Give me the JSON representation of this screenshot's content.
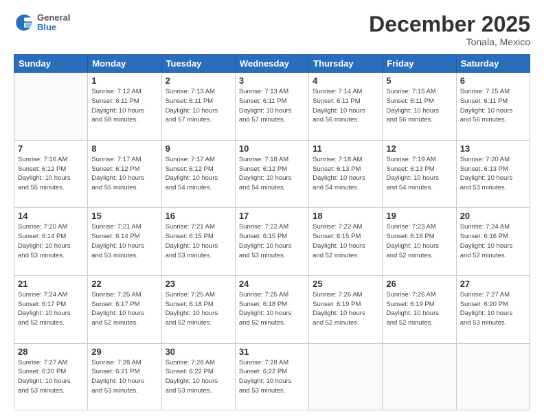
{
  "header": {
    "logo": {
      "general": "General",
      "blue": "Blue"
    },
    "title": "December 2025",
    "location": "Tonala, Mexico"
  },
  "calendar": {
    "days_of_week": [
      "Sunday",
      "Monday",
      "Tuesday",
      "Wednesday",
      "Thursday",
      "Friday",
      "Saturday"
    ],
    "weeks": [
      [
        {
          "day": "",
          "info": ""
        },
        {
          "day": "1",
          "info": "Sunrise: 7:12 AM\nSunset: 6:11 PM\nDaylight: 10 hours\nand 58 minutes."
        },
        {
          "day": "2",
          "info": "Sunrise: 7:13 AM\nSunset: 6:11 PM\nDaylight: 10 hours\nand 57 minutes."
        },
        {
          "day": "3",
          "info": "Sunrise: 7:13 AM\nSunset: 6:11 PM\nDaylight: 10 hours\nand 57 minutes."
        },
        {
          "day": "4",
          "info": "Sunrise: 7:14 AM\nSunset: 6:11 PM\nDaylight: 10 hours\nand 56 minutes."
        },
        {
          "day": "5",
          "info": "Sunrise: 7:15 AM\nSunset: 6:11 PM\nDaylight: 10 hours\nand 56 minutes."
        },
        {
          "day": "6",
          "info": "Sunrise: 7:15 AM\nSunset: 6:11 PM\nDaylight: 10 hours\nand 56 minutes."
        }
      ],
      [
        {
          "day": "7",
          "info": "Sunrise: 7:16 AM\nSunset: 6:12 PM\nDaylight: 10 hours\nand 55 minutes."
        },
        {
          "day": "8",
          "info": "Sunrise: 7:17 AM\nSunset: 6:12 PM\nDaylight: 10 hours\nand 55 minutes."
        },
        {
          "day": "9",
          "info": "Sunrise: 7:17 AM\nSunset: 6:12 PM\nDaylight: 10 hours\nand 54 minutes."
        },
        {
          "day": "10",
          "info": "Sunrise: 7:18 AM\nSunset: 6:12 PM\nDaylight: 10 hours\nand 54 minutes."
        },
        {
          "day": "11",
          "info": "Sunrise: 7:18 AM\nSunset: 6:13 PM\nDaylight: 10 hours\nand 54 minutes."
        },
        {
          "day": "12",
          "info": "Sunrise: 7:19 AM\nSunset: 6:13 PM\nDaylight: 10 hours\nand 54 minutes."
        },
        {
          "day": "13",
          "info": "Sunrise: 7:20 AM\nSunset: 6:13 PM\nDaylight: 10 hours\nand 53 minutes."
        }
      ],
      [
        {
          "day": "14",
          "info": "Sunrise: 7:20 AM\nSunset: 6:14 PM\nDaylight: 10 hours\nand 53 minutes."
        },
        {
          "day": "15",
          "info": "Sunrise: 7:21 AM\nSunset: 6:14 PM\nDaylight: 10 hours\nand 53 minutes."
        },
        {
          "day": "16",
          "info": "Sunrise: 7:21 AM\nSunset: 6:15 PM\nDaylight: 10 hours\nand 53 minutes."
        },
        {
          "day": "17",
          "info": "Sunrise: 7:22 AM\nSunset: 6:15 PM\nDaylight: 10 hours\nand 53 minutes."
        },
        {
          "day": "18",
          "info": "Sunrise: 7:22 AM\nSunset: 6:15 PM\nDaylight: 10 hours\nand 52 minutes."
        },
        {
          "day": "19",
          "info": "Sunrise: 7:23 AM\nSunset: 6:16 PM\nDaylight: 10 hours\nand 52 minutes."
        },
        {
          "day": "20",
          "info": "Sunrise: 7:24 AM\nSunset: 6:16 PM\nDaylight: 10 hours\nand 52 minutes."
        }
      ],
      [
        {
          "day": "21",
          "info": "Sunrise: 7:24 AM\nSunset: 6:17 PM\nDaylight: 10 hours\nand 52 minutes."
        },
        {
          "day": "22",
          "info": "Sunrise: 7:25 AM\nSunset: 6:17 PM\nDaylight: 10 hours\nand 52 minutes."
        },
        {
          "day": "23",
          "info": "Sunrise: 7:25 AM\nSunset: 6:18 PM\nDaylight: 10 hours\nand 52 minutes."
        },
        {
          "day": "24",
          "info": "Sunrise: 7:25 AM\nSunset: 6:18 PM\nDaylight: 10 hours\nand 52 minutes."
        },
        {
          "day": "25",
          "info": "Sunrise: 7:26 AM\nSunset: 6:19 PM\nDaylight: 10 hours\nand 52 minutes."
        },
        {
          "day": "26",
          "info": "Sunrise: 7:26 AM\nSunset: 6:19 PM\nDaylight: 10 hours\nand 52 minutes."
        },
        {
          "day": "27",
          "info": "Sunrise: 7:27 AM\nSunset: 6:20 PM\nDaylight: 10 hours\nand 53 minutes."
        }
      ],
      [
        {
          "day": "28",
          "info": "Sunrise: 7:27 AM\nSunset: 6:20 PM\nDaylight: 10 hours\nand 53 minutes."
        },
        {
          "day": "29",
          "info": "Sunrise: 7:28 AM\nSunset: 6:21 PM\nDaylight: 10 hours\nand 53 minutes."
        },
        {
          "day": "30",
          "info": "Sunrise: 7:28 AM\nSunset: 6:22 PM\nDaylight: 10 hours\nand 53 minutes."
        },
        {
          "day": "31",
          "info": "Sunrise: 7:28 AM\nSunset: 6:22 PM\nDaylight: 10 hours\nand 53 minutes."
        },
        {
          "day": "",
          "info": ""
        },
        {
          "day": "",
          "info": ""
        },
        {
          "day": "",
          "info": ""
        }
      ]
    ]
  }
}
